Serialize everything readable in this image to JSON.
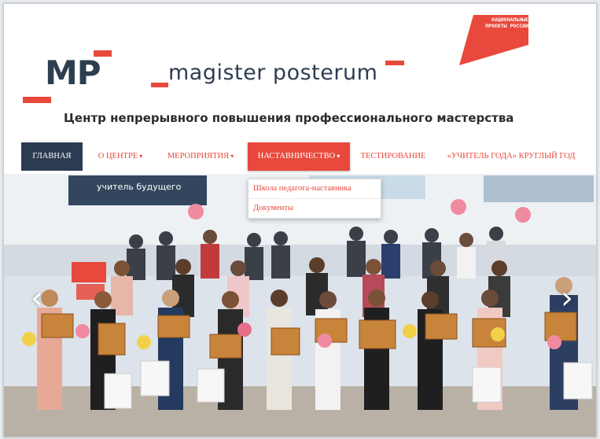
{
  "header": {
    "logo_text": "MP",
    "brand_name": "magister posterum",
    "national_projects_badge": "НАЦИОНАЛЬНЫЕ ПРОЕКТЫ РОССИИ",
    "tagline": "Центр непрерывного повышения профессионального мастерства"
  },
  "nav": {
    "items": [
      {
        "label": "ГЛАВНАЯ",
        "has_caret": false
      },
      {
        "label": "О ЦЕНТРЕ",
        "has_caret": true
      },
      {
        "label": "МЕРОПРИЯТИЯ",
        "has_caret": true
      },
      {
        "label": "НАСТАВНИЧЕСТВО",
        "has_caret": true
      },
      {
        "label": "ТЕСТИРОВАНИЕ",
        "has_caret": false
      },
      {
        "label": "«УЧИТЕЛЬ ГОДА» КРУГЛЫЙ ГОД",
        "has_caret": false
      }
    ],
    "caret_glyph": "▾"
  },
  "dropdown": {
    "items": [
      {
        "label": "Школа педагога-наставника"
      },
      {
        "label": "Документы"
      }
    ]
  },
  "slider": {
    "banner_text": "учитель будущего",
    "prev_glyph": "‹",
    "next_glyph": "›"
  },
  "colors": {
    "accent": "#e8493c",
    "navy": "#2d3b52",
    "brand_text": "#2d3e50"
  }
}
